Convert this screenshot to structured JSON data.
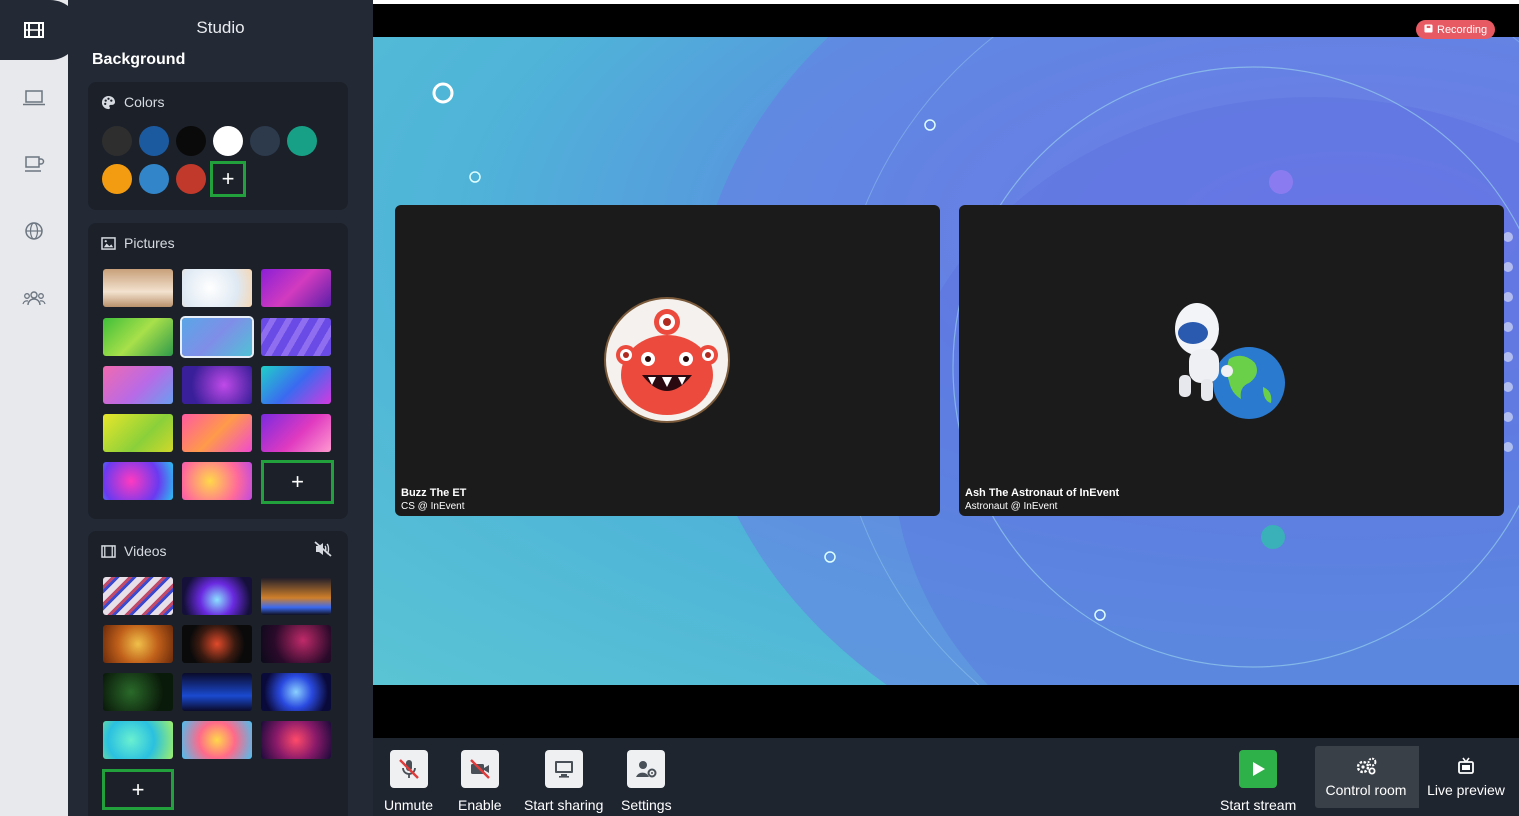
{
  "studio": {
    "title": "Studio",
    "section": "Background"
  },
  "colors": {
    "label": "Colors",
    "swatches": [
      "#2e2e2e",
      "#1c5aa0",
      "#0a0a0a",
      "#ffffff",
      "#2c3a4c",
      "#17a085",
      "#f39c12",
      "#3185c8",
      "#c0392b"
    ],
    "add_label": "+"
  },
  "pictures": {
    "label": "Pictures",
    "add_label": "+"
  },
  "videos": {
    "label": "Videos",
    "add_label": "+"
  },
  "stage": {
    "recording_label": "Recording",
    "participants": [
      {
        "name": "Buzz The ET",
        "role": "CS @ InEvent"
      },
      {
        "name": "Ash The Astronaut of InEvent",
        "role": "Astronaut @ InEvent"
      }
    ]
  },
  "toolbar": {
    "unmute": "Unmute",
    "enable": "Enable",
    "start_sharing": "Start sharing",
    "settings": "Settings",
    "start_stream": "Start stream",
    "control_room": "Control room",
    "live_preview": "Live preview"
  },
  "icons": {
    "rail": [
      "film-icon",
      "laptop-icon",
      "coffee-icon",
      "globe-icon",
      "users-icon"
    ],
    "accent_green": "#21a03c",
    "record_red": "#e85a63"
  }
}
